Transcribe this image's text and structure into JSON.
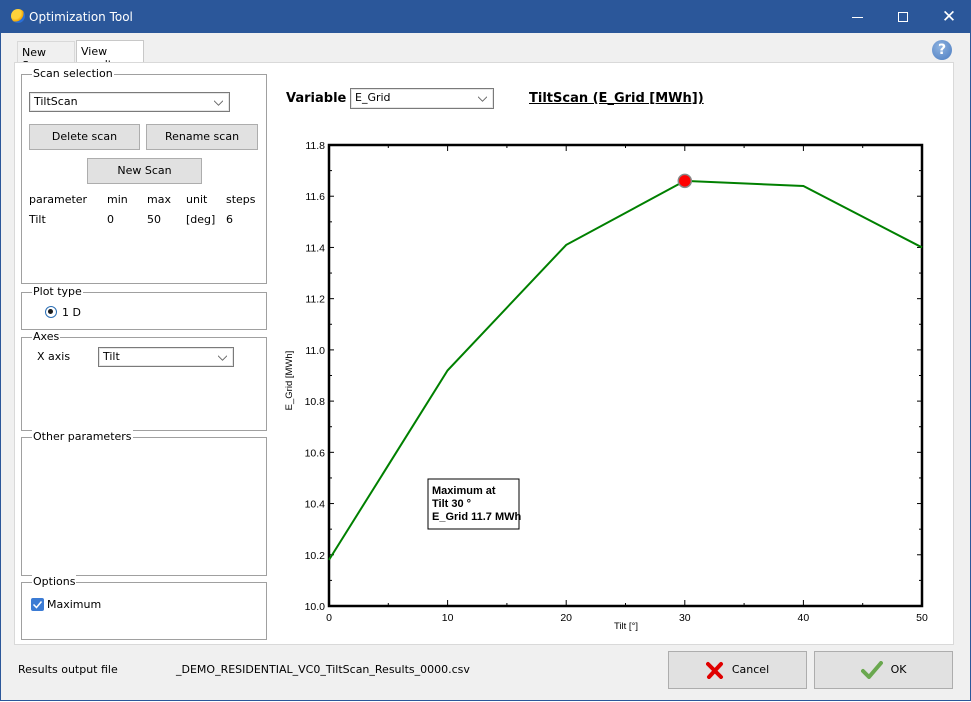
{
  "window": {
    "title": "Optimization Tool",
    "controls": {
      "minimize": "minimize-icon",
      "maximize": "maximize-icon",
      "close": "close-icon"
    }
  },
  "tabs": [
    {
      "label": "New Scan",
      "active": false
    },
    {
      "label": "View results",
      "active": true
    }
  ],
  "help_icon": "?",
  "scan_selection": {
    "title": "Scan selection",
    "selected_scan": "TiltScan",
    "delete_label": "Delete scan",
    "rename_label": "Rename scan",
    "new_scan_label": "New Scan",
    "table": {
      "headers": [
        "parameter",
        "min",
        "max",
        "unit",
        "steps"
      ],
      "rows": [
        [
          "Tilt",
          "0",
          "50",
          "[deg]",
          "6"
        ]
      ]
    }
  },
  "plot_type": {
    "title": "Plot type",
    "option_label": "1 D",
    "selected": true
  },
  "axes": {
    "title": "Axes",
    "x_axis_label": "X axis",
    "x_axis_value": "Tilt"
  },
  "other_parameters": {
    "title": "Other parameters"
  },
  "options": {
    "title": "Options",
    "maximum_label": "Maximum",
    "maximum_checked": true
  },
  "variable": {
    "label": "Variable",
    "value": "E_Grid"
  },
  "chart_data": {
    "type": "line",
    "title": "TiltScan (E_Grid [MWh])",
    "xlabel": "Tilt [°]",
    "ylabel": "E_Grid [MWh]",
    "x": [
      0,
      10,
      20,
      30,
      40,
      50
    ],
    "series": [
      {
        "name": "E_Grid",
        "color": "#008000",
        "values": [
          10.18,
          10.92,
          11.41,
          11.66,
          11.64,
          11.4
        ]
      }
    ],
    "xlim": [
      0,
      50
    ],
    "ylim": [
      10.0,
      11.8
    ],
    "x_ticks": [
      "0",
      "10",
      "20",
      "30",
      "40",
      "50"
    ],
    "y_ticks": [
      "10.0",
      "10.2",
      "10.4",
      "10.6",
      "10.8",
      "11.0",
      "11.2",
      "11.4",
      "11.6",
      "11.8"
    ],
    "grid": false,
    "maximum_marker": {
      "x": 30,
      "y": 11.66,
      "color": "#ff0000"
    },
    "annotation": [
      "Maximum at",
      "Tilt 30 °",
      "E_Grid 11.7 MWh"
    ]
  },
  "footer": {
    "results_label": "Results output file",
    "results_file": "_DEMO_RESIDENTIAL_VC0_TiltScan_Results_0000.csv",
    "cancel_label": "Cancel",
    "ok_label": "OK"
  }
}
